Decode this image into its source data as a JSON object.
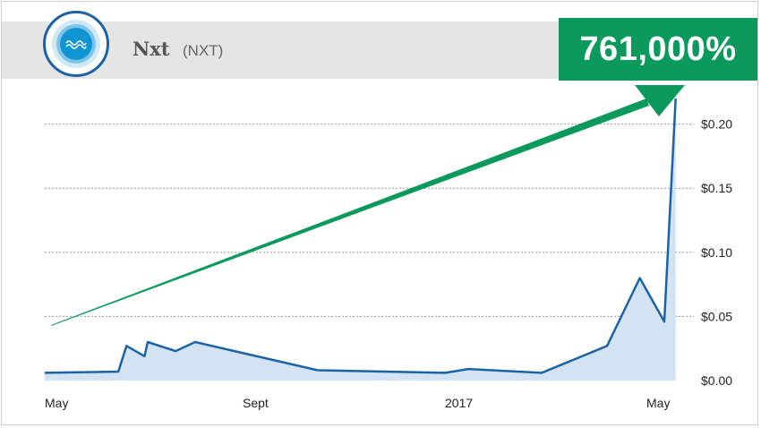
{
  "header": {
    "coin_name": "Nxt",
    "coin_ticker": "(NXT)",
    "gain": "761,000%"
  },
  "colors": {
    "line": "#1b63a7",
    "area": "#d4e3f3",
    "arrow": "#0b9a5b",
    "header_bg": "#e5e5e5",
    "gain_bg": "#0b9a5b"
  },
  "icons": {
    "logo": "nxt-logo-icon",
    "arrow": "trend-arrow-icon"
  },
  "chart_data": {
    "type": "area",
    "x_tick_labels": [
      "May",
      "Sept",
      "2017",
      "May"
    ],
    "y_tick_labels": [
      "$0.00",
      "$0.05",
      "$0.10",
      "$0.15",
      "$0.20"
    ],
    "y_ticks": [
      0,
      0.05,
      0.1,
      0.15,
      0.2
    ],
    "ylim": [
      0,
      0.22
    ],
    "x_range": [
      "2016-05-01",
      "2017-06-01"
    ],
    "grid": true,
    "series": [
      {
        "x": [
          "2016-05-01",
          "2016-06-15",
          "2016-06-20",
          "2016-07-01",
          "2016-07-03",
          "2016-07-20",
          "2016-08-01",
          "2016-10-15",
          "2017-01-01",
          "2017-01-15",
          "2017-03-01",
          "2017-04-10",
          "2017-04-30",
          "2017-05-15",
          "2017-05-22"
        ],
        "y": [
          0.006,
          0.007,
          0.027,
          0.019,
          0.03,
          0.023,
          0.03,
          0.008,
          0.006,
          0.009,
          0.006,
          0.027,
          0.08,
          0.046,
          0.22
        ]
      }
    ]
  }
}
